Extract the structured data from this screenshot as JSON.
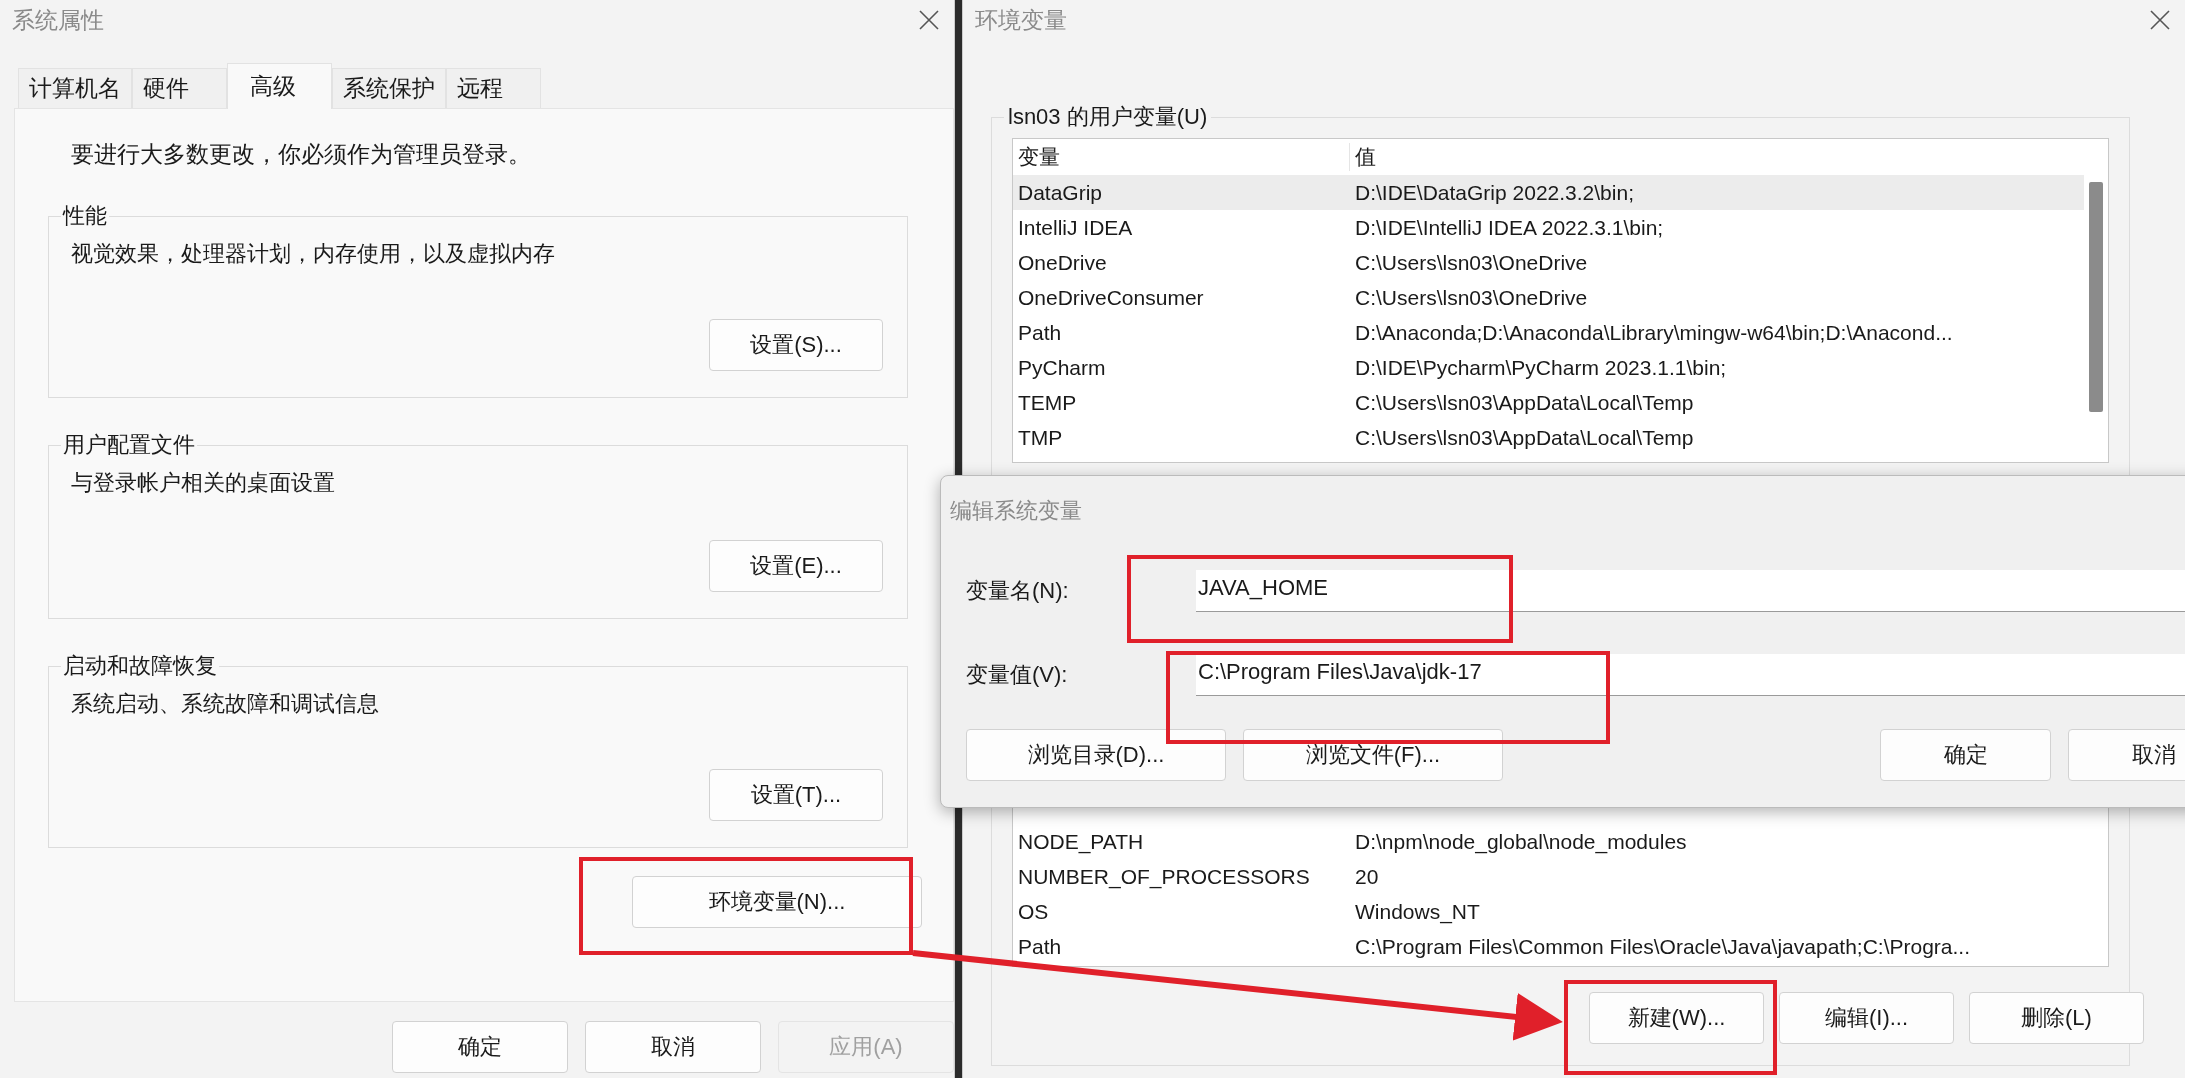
{
  "system_properties": {
    "title": "系统属性",
    "tabs": [
      {
        "label": "计算机名",
        "selected": false
      },
      {
        "label": "硬件",
        "selected": false
      },
      {
        "label": "高级",
        "selected": true
      },
      {
        "label": "系统保护",
        "selected": false
      },
      {
        "label": "远程",
        "selected": false
      }
    ],
    "notice": "要进行大多数更改，你必须作为管理员登录。",
    "groups": [
      {
        "title": "性能",
        "description": "视觉效果，处理器计划，内存使用，以及虚拟内存",
        "button": "设置(S)..."
      },
      {
        "title": "用户配置文件",
        "description": "与登录帐户相关的桌面设置",
        "button": "设置(E)..."
      },
      {
        "title": "启动和故障恢复",
        "description": "系统启动、系统故障和调试信息",
        "button": "设置(T)..."
      }
    ],
    "env_button": "环境变量(N)...",
    "buttons": [
      {
        "label": "确定",
        "disabled": false
      },
      {
        "label": "取消",
        "disabled": false
      },
      {
        "label": "应用(A)",
        "disabled": true
      }
    ]
  },
  "environment_variables": {
    "title": "环境变量",
    "user_vars": {
      "title": "lsn03 的用户变量(U)",
      "columns": [
        "变量",
        "值"
      ],
      "rows": [
        {
          "name": "DataGrip",
          "value": "D:\\IDE\\DataGrip 2022.3.2\\bin;",
          "selected": true
        },
        {
          "name": "IntelliJ IDEA",
          "value": "D:\\IDE\\IntelliJ IDEA 2022.3.1\\bin;",
          "selected": false
        },
        {
          "name": "OneDrive",
          "value": "C:\\Users\\lsn03\\OneDrive",
          "selected": false
        },
        {
          "name": "OneDriveConsumer",
          "value": "C:\\Users\\lsn03\\OneDrive",
          "selected": false
        },
        {
          "name": "Path",
          "value": "D:\\Anaconda;D:\\Anaconda\\Library\\mingw-w64\\bin;D:\\Anacond...",
          "selected": false
        },
        {
          "name": "PyCharm",
          "value": "D:\\IDE\\Pycharm\\PyCharm 2023.1.1\\bin;",
          "selected": false
        },
        {
          "name": "TEMP",
          "value": "C:\\Users\\lsn03\\AppData\\Local\\Temp",
          "selected": false
        },
        {
          "name": "TMP",
          "value": "C:\\Users\\lsn03\\AppData\\Local\\Temp",
          "selected": false
        }
      ]
    },
    "system_vars": {
      "rows": [
        {
          "name": "NODE_PATH",
          "value": "D:\\npm\\node_global\\node_modules"
        },
        {
          "name": "NUMBER_OF_PROCESSORS",
          "value": "20"
        },
        {
          "name": "OS",
          "value": "Windows_NT"
        },
        {
          "name": "Path",
          "value": "C:\\Program Files\\Common Files\\Oracle\\Java\\javapath;C:\\Progra..."
        }
      ]
    },
    "buttons": [
      "新建(W)...",
      "编辑(I)...",
      "删除(L)"
    ]
  },
  "edit_dialog": {
    "title": "编辑系统变量",
    "fields": [
      {
        "label": "变量名(N):",
        "value": "JAVA_HOME"
      },
      {
        "label": "变量值(V):",
        "value": "C:\\Program Files\\Java\\jdk-17"
      }
    ],
    "left_buttons": [
      "浏览目录(D)...",
      "浏览文件(F)..."
    ],
    "right_buttons": [
      "确定",
      "取消"
    ]
  }
}
